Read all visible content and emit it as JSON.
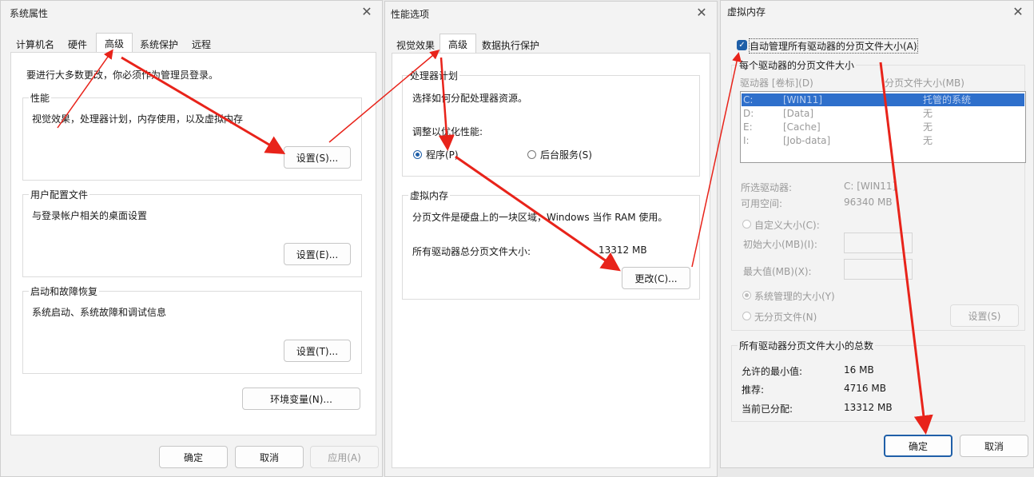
{
  "sys_props": {
    "title": "系统属性",
    "tabs": [
      "计算机名",
      "硬件",
      "高级",
      "系统保护",
      "远程"
    ],
    "admin_note": "要进行大多数更改，你必须作为管理员登录。",
    "performance": {
      "title": "性能",
      "desc": "视觉效果，处理器计划，内存使用，以及虚拟内存",
      "button": "设置(S)..."
    },
    "user_profile": {
      "title": "用户配置文件",
      "desc": "与登录帐户相关的桌面设置",
      "button": "设置(E)..."
    },
    "startup": {
      "title": "启动和故障恢复",
      "desc": "系统启动、系统故障和调试信息",
      "button": "设置(T)..."
    },
    "env_button": "环境变量(N)...",
    "ok": "确定",
    "cancel": "取消",
    "apply": "应用(A)"
  },
  "perf_opts": {
    "title": "性能选项",
    "tabs": [
      "视觉效果",
      "高级",
      "数据执行保护"
    ],
    "cpu": {
      "title": "处理器计划",
      "desc": "选择如何分配处理器资源。",
      "adjust": "调整以优化性能:",
      "programs": "程序(P)",
      "background": "后台服务(S)"
    },
    "vm": {
      "title": "虚拟内存",
      "desc": "分页文件是硬盘上的一块区域，Windows 当作 RAM 使用。",
      "total_label": "所有驱动器总分页文件大小:",
      "total_value": "13312 MB",
      "change_button": "更改(C)..."
    }
  },
  "vmem": {
    "title": "虚拟内存",
    "auto_manage": "自动管理所有驱动器的分页文件大小(A)",
    "per_drive_title": "每个驱动器的分页文件大小",
    "col_drive": "驱动器 [卷标](D)",
    "col_size": "分页文件大小(MB)",
    "drives": [
      {
        "letter": "C:",
        "label": "[WIN11]",
        "size": "托管的系统"
      },
      {
        "letter": "D:",
        "label": "[Data]",
        "size": "无"
      },
      {
        "letter": "E:",
        "label": "[Cache]",
        "size": "无"
      },
      {
        "letter": "I:",
        "label": "[Job-data]",
        "size": "无"
      }
    ],
    "selected_drive_label": "所选驱动器:",
    "selected_drive_value": "C:  [WIN11]",
    "free_space_label": "可用空间:",
    "free_space_value": "96340 MB",
    "custom_size": "自定义大小(C):",
    "initial_size": "初始大小(MB)(I):",
    "max_size": "最大值(MB)(X):",
    "system_managed": "系统管理的大小(Y)",
    "no_paging": "无分页文件(N)",
    "set_button": "设置(S)",
    "totals_title": "所有驱动器分页文件大小的总数",
    "min_allowed_label": "允许的最小值:",
    "min_allowed_value": "16 MB",
    "recommended_label": "推荐:",
    "recommended_value": "4716 MB",
    "current_label": "当前已分配:",
    "current_value": "13312 MB",
    "ok": "确定",
    "cancel": "取消"
  },
  "colors": {
    "accent": "#1f5fa8",
    "arrow": "#e8231a",
    "selection": "#2e6fcb"
  }
}
